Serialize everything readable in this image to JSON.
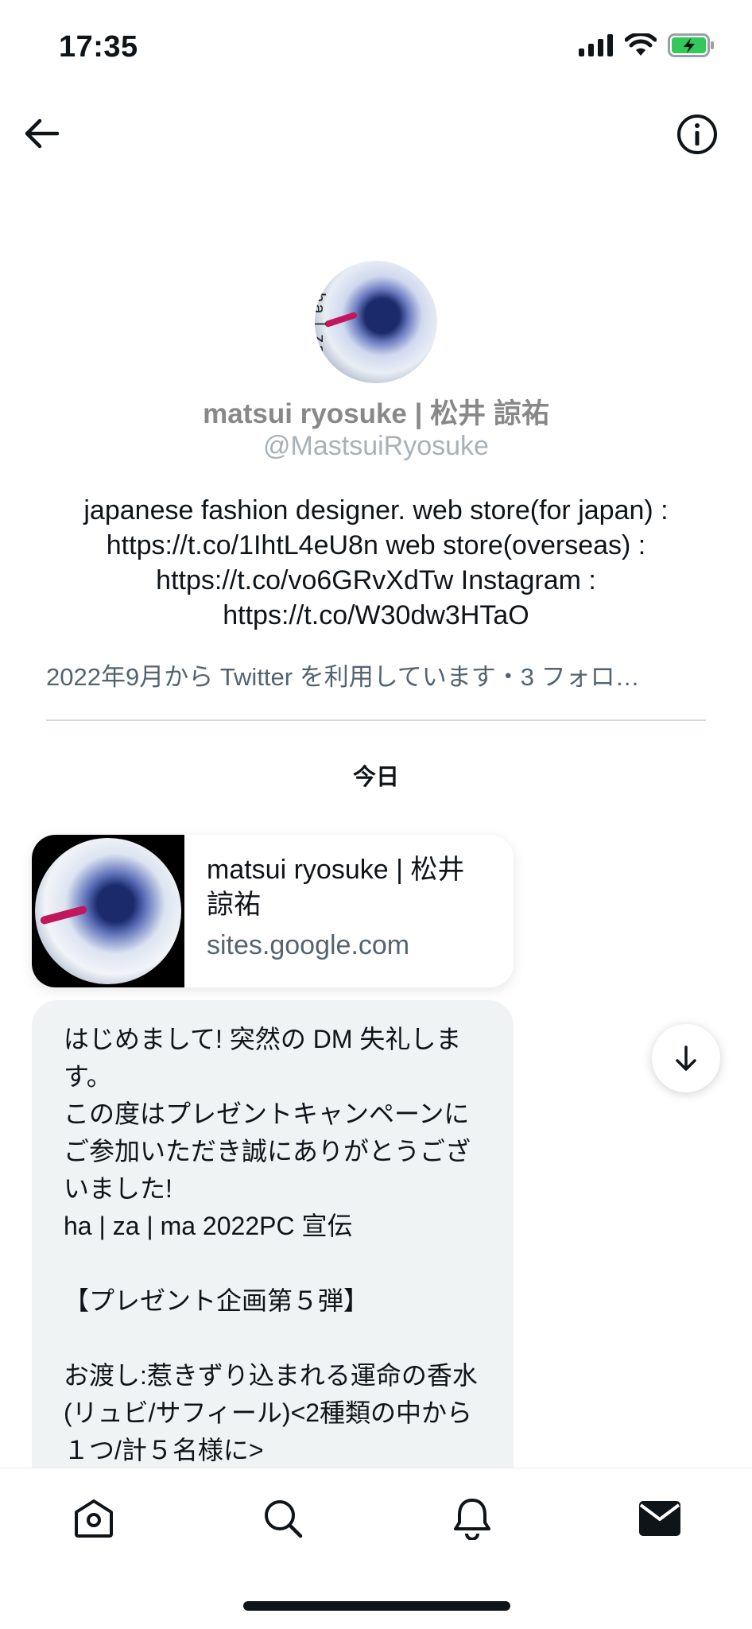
{
  "status_bar": {
    "time": "17:35"
  },
  "header": {
    "back_icon": "arrow-left-icon",
    "info_icon": "info-circle-icon"
  },
  "profile": {
    "avatar_overlay_text": "ha | za | ma",
    "name": "matsui ryosuke | 松井 諒祐",
    "handle": "@MastsuiRyosuke",
    "bio": "japanese fashion designer. web store(for japan) : https://t.co/1IhtL4eU8n web store(overseas) : https://t.co/vo6GRvXdTw Instagram : https://t.co/W30dw3HTaO",
    "meta": "2022年9月から Twitter を利用しています・3 フォロ…"
  },
  "conversation": {
    "date_label": "今日",
    "link_card": {
      "title": "matsui ryosuke | 松井 諒祐",
      "domain": "sites.google.com"
    },
    "message": "はじめまして! 突然の DM 失礼します。\nこの度はプレゼントキャンペーンにご参加いただき誠にありがとうございました!\nha | za | ma 2022PC 宣伝\n\n【プレゼント企画第５弾】\n\nお渡し:惹きずり込まれる運命の香水(リュビ/サフィール)<2種類の中から１つ/計５名様に>"
  },
  "tabbar": {
    "items": [
      {
        "icon": "home-icon",
        "active": false
      },
      {
        "icon": "search-icon",
        "active": false
      },
      {
        "icon": "bell-icon",
        "active": false
      },
      {
        "icon": "mail-icon",
        "active": true
      }
    ]
  },
  "colors": {
    "text": "#0f1419",
    "secondary": "#536471",
    "bubble": "#eff3f4",
    "battery": "#34c759"
  }
}
